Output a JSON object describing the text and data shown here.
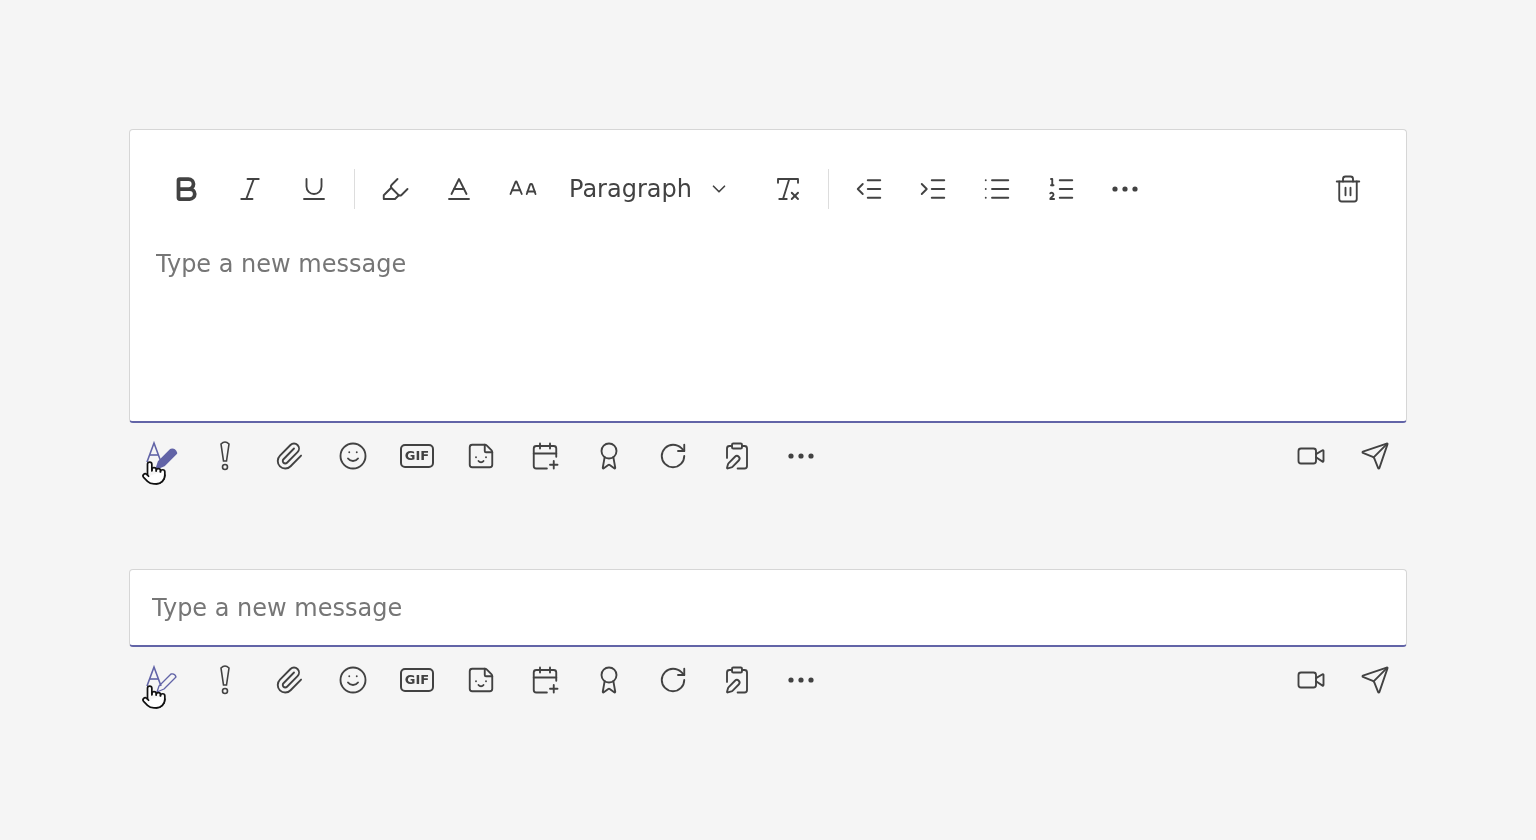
{
  "composers": [
    {
      "expanded": true,
      "placeholder": "Type a new message",
      "format_selected": true,
      "paragraph_label": "Paragraph",
      "gif_label": "GIF"
    },
    {
      "expanded": false,
      "placeholder": "Type a new message",
      "format_selected": false,
      "gif_label": "GIF"
    }
  ]
}
